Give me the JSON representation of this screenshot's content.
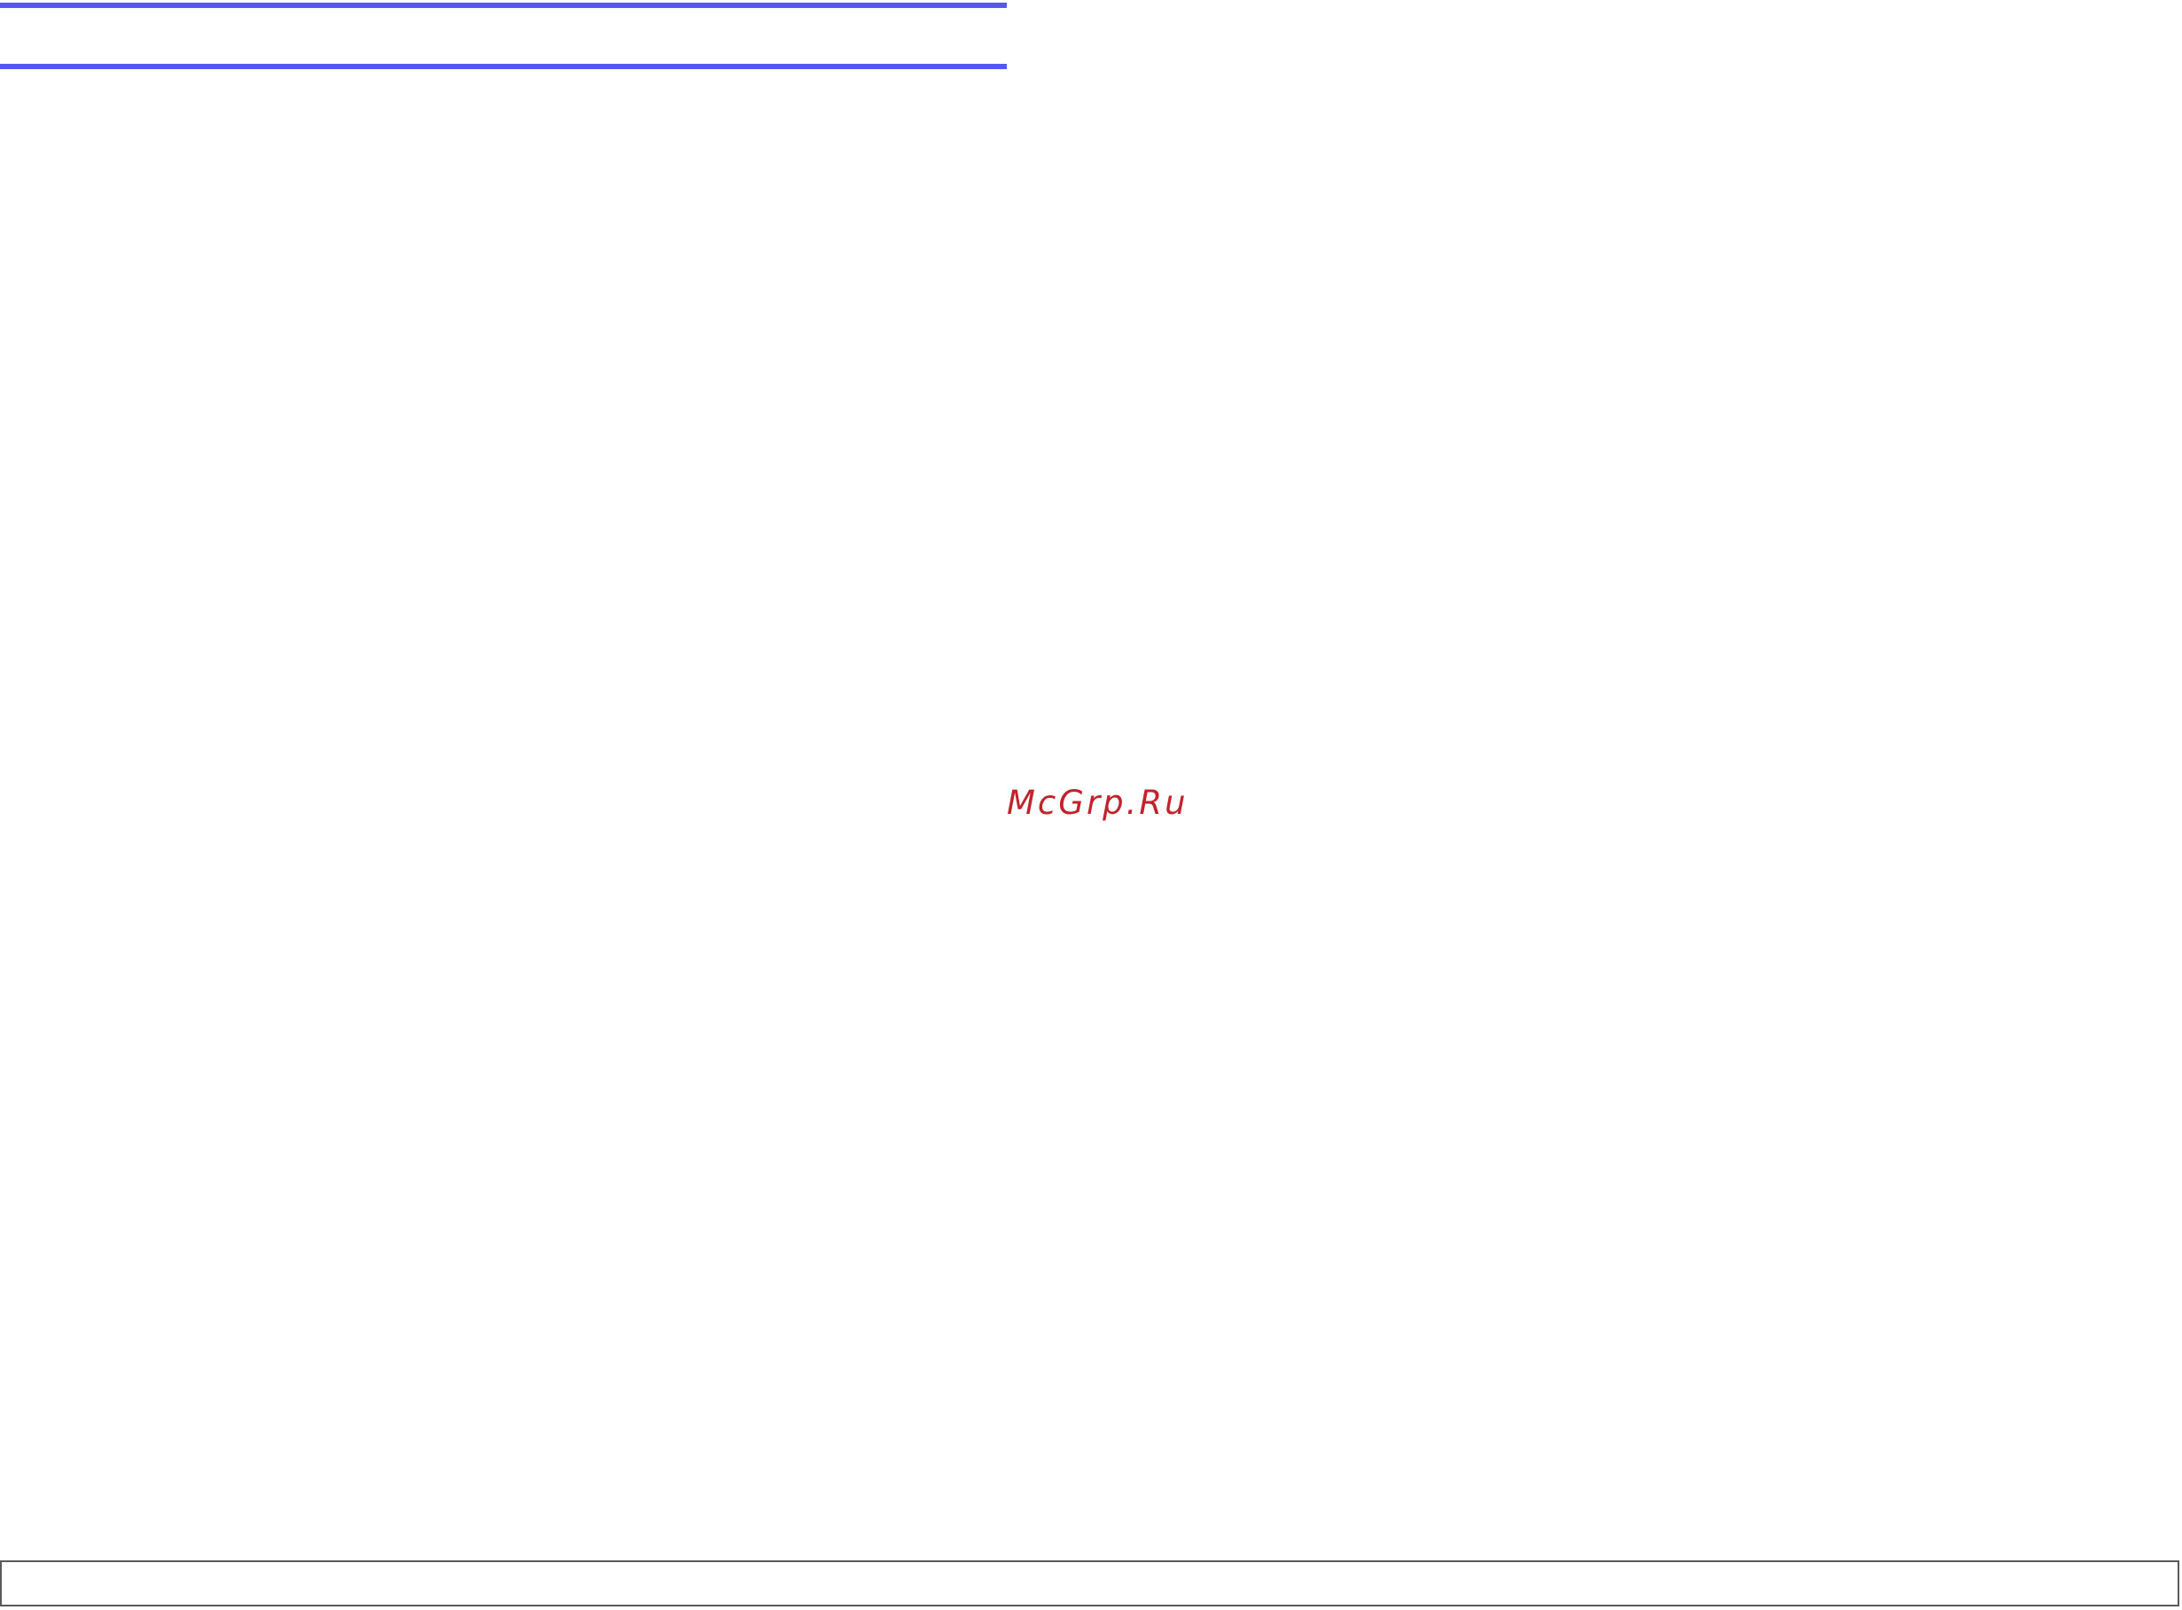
{
  "page": {
    "background": "#ffffff"
  },
  "header": {
    "rule_color": "#5458f0"
  },
  "watermark": {
    "text": "McGrp.Ru",
    "color": "#c0232b"
  },
  "footer": {
    "border_color": "#5a5a5a"
  }
}
